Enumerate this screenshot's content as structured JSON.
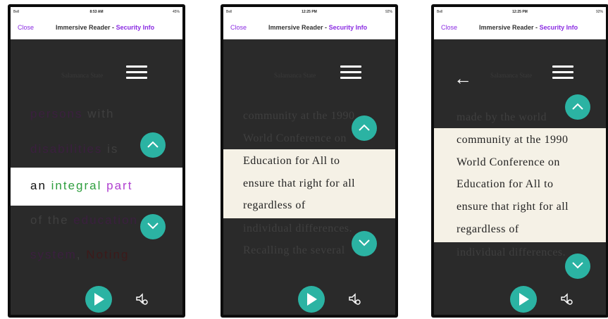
{
  "screens": [
    {
      "status": {
        "carrier": "Bell",
        "time": "8:53 AM",
        "battery": "45%"
      },
      "nav": {
        "close": "Close",
        "title": "Immersive Reader -",
        "link": "Security Info"
      },
      "header": "Salamanca State",
      "lines": [
        [
          {
            "t": "persons ",
            "c": "#3b1f3f"
          },
          {
            "t": "with",
            "c": "#3f3f3f"
          }
        ],
        [
          {
            "t": "disabilities ",
            "c": "#3b1f3f"
          },
          {
            "t": "is",
            "c": "#3f3f3f"
          }
        ],
        [
          {
            "t": "an ",
            "c": "#111111"
          },
          {
            "t": "integral ",
            "c": "#2e9e3e"
          },
          {
            "t": "part",
            "c": "#b040d0"
          }
        ],
        [
          {
            "t": "of the ",
            "c": "#3f3f3f"
          },
          {
            "t": "education",
            "c": "#3b1f3f"
          }
        ],
        [
          {
            "t": "system",
            "c": "#3b1f3f"
          },
          {
            "t": ", ",
            "c": "#3f3f3f"
          },
          {
            "t": "Noting",
            "c": "#3d1a1a"
          }
        ]
      ]
    },
    {
      "status": {
        "carrier": "Bell",
        "time": "12:25 PM",
        "battery": "92%"
      },
      "nav": {
        "close": "Close",
        "title": "Immersive Reader -",
        "link": "Security Info"
      },
      "header": "Salamanca State",
      "lines": [
        "community at the 1990",
        "World Conference on",
        "Education for All to",
        "ensure that right for all",
        "regardless of",
        "individual differences.",
        "Recalling the several"
      ]
    },
    {
      "status": {
        "carrier": "Bell",
        "time": "12:25 PM",
        "battery": "92%"
      },
      "nav": {
        "close": "Close",
        "title": "Immersive Reader -",
        "link": "Security Info"
      },
      "header": "Salamanca State",
      "lines": [
        "made by the world",
        "community at the 1990",
        "World Conference on",
        "Education for All to",
        "ensure that right for all",
        "regardless of",
        "individual differences."
      ]
    }
  ],
  "colors": {
    "accent": "#2bb3a3",
    "link": "#8a2be2",
    "reader_bg": "#2a2a2a",
    "highlight_serif": "#f5f1e6",
    "highlight_sans": "#ffffff"
  },
  "icons": {
    "play": "play-icon",
    "voice": "voice-settings-icon",
    "up": "chevron-up-icon",
    "down": "chevron-down-icon",
    "menu": "hamburger-menu-icon",
    "back": "back-arrow-icon"
  }
}
